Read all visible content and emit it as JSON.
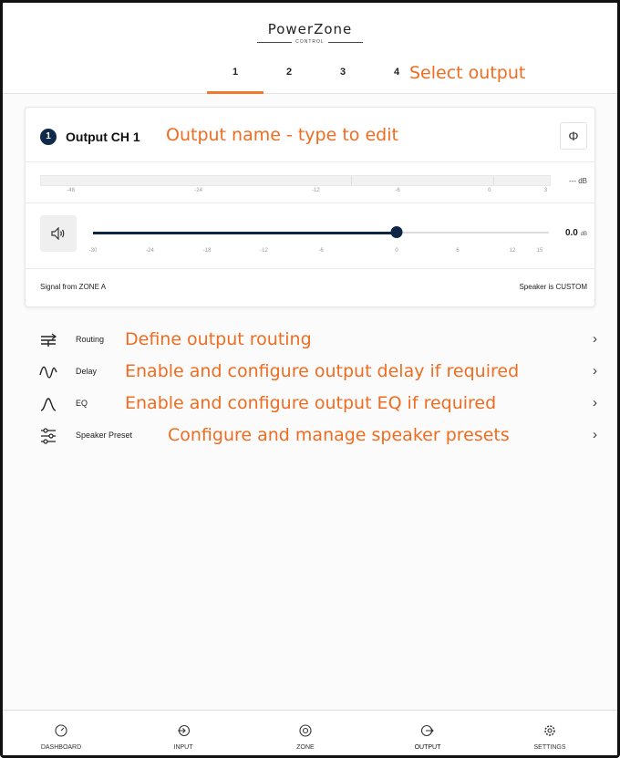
{
  "app": {
    "title": "PowerZone",
    "subtitle": "CONTROL"
  },
  "tabs": [
    {
      "label": "1",
      "active": true
    },
    {
      "label": "2",
      "active": false
    },
    {
      "label": "3",
      "active": false
    },
    {
      "label": "4",
      "active": false
    }
  ],
  "annotations": {
    "select_output": "Select output",
    "output_name": "Output name - type to edit",
    "routing": "Define output routing",
    "delay": "Enable and configure output delay if required",
    "eq": "Enable and configure output EQ if required",
    "speaker_preset": "Configure and manage speaker presets"
  },
  "output": {
    "badge": "1",
    "name": "Output CH 1",
    "phase_icon": "phase-icon",
    "meter_value": "--- dB",
    "meter_ticks": [
      "-48",
      "-24",
      "-12",
      "-6",
      "0",
      "3"
    ],
    "volume_value": "0.0",
    "volume_unit": "dB",
    "volume_level_db": 0,
    "volume_ticks": [
      "-30",
      "-24",
      "-18",
      "-12",
      "-6",
      "0",
      "6",
      "12",
      "15"
    ],
    "signal_from": "Signal from ZONE A",
    "speaker_is": "Speaker is CUSTOM"
  },
  "menu": [
    {
      "label": "Routing",
      "icon": "routing-icon"
    },
    {
      "label": "Delay",
      "icon": "delay-icon"
    },
    {
      "label": "EQ",
      "icon": "eq-icon"
    },
    {
      "label": "Speaker Preset",
      "icon": "speaker-preset-icon"
    }
  ],
  "nav": [
    {
      "label": "DASHBOARD",
      "icon": "dashboard-icon",
      "active": false
    },
    {
      "label": "INPUT",
      "icon": "input-icon",
      "active": false
    },
    {
      "label": "ZONE",
      "icon": "zone-icon",
      "active": false
    },
    {
      "label": "OUTPUT",
      "icon": "output-icon",
      "active": true
    },
    {
      "label": "SETTINGS",
      "icon": "settings-icon",
      "active": false
    }
  ],
  "colors": {
    "accent": "#ef7a2b",
    "annotation": "#ef6c20",
    "primary": "#0e2747"
  }
}
